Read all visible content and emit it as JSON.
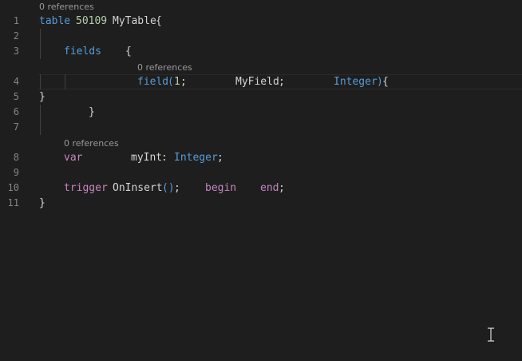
{
  "editor": {
    "line_numbers": [
      "1",
      "2",
      "3",
      "4",
      "5",
      "6",
      "7",
      "8",
      "9",
      "10",
      "11"
    ],
    "lens": {
      "table": "0 references",
      "field": "0 references",
      "var": "0 references"
    },
    "line1": {
      "kw": "table",
      "num": "50109",
      "name": "MyTable",
      "brace": "{"
    },
    "line3": {
      "kw": "fields",
      "brace": "{"
    },
    "line4": {
      "kw": "field",
      "open": "(",
      "num": "1",
      "sep1": ";",
      "name": "MyField",
      "sep2": ";",
      "type": "Integer",
      "close": ")",
      "brace": "{"
    },
    "line5": {
      "brace": "}"
    },
    "line6": {
      "brace": "}"
    },
    "line8": {
      "kw": "var",
      "name": "myInt",
      "colon": ":",
      "type": "Integer",
      "semi": ";"
    },
    "line10": {
      "kw": "trigger",
      "name": "OnInsert",
      "parens": "()",
      "semi": ";",
      "begin": "begin",
      "end": "end",
      "semi2": ";"
    },
    "line11": {
      "brace": "}"
    }
  },
  "cursor_icon": "text-cursor-icon"
}
